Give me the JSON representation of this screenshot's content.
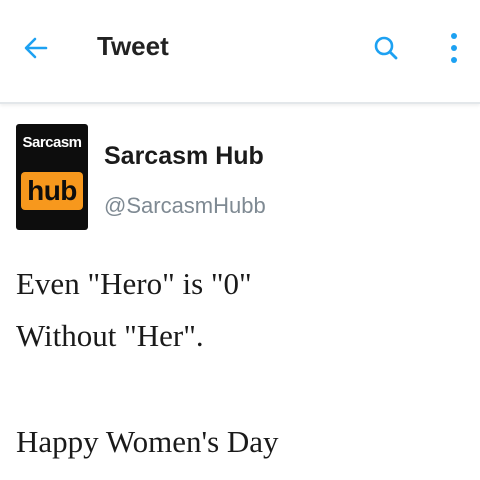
{
  "header": {
    "title": "Tweet",
    "back_icon": "back-arrow-icon",
    "search_icon": "search-icon",
    "more_icon": "more-vertical-icon",
    "accent_color": "#1da1f2"
  },
  "author": {
    "avatar": {
      "top_text": "Sarcasm",
      "bottom_text": "hub",
      "bg_color": "#0d0d0d",
      "badge_color": "#f7981d"
    },
    "name": "Sarcasm Hub",
    "handle": "@SarcasmHubb"
  },
  "tweet": {
    "lines": [
      "Even \"Hero\" is \"0\"",
      "Without \"Her\".",
      "Happy Women's Day"
    ]
  }
}
